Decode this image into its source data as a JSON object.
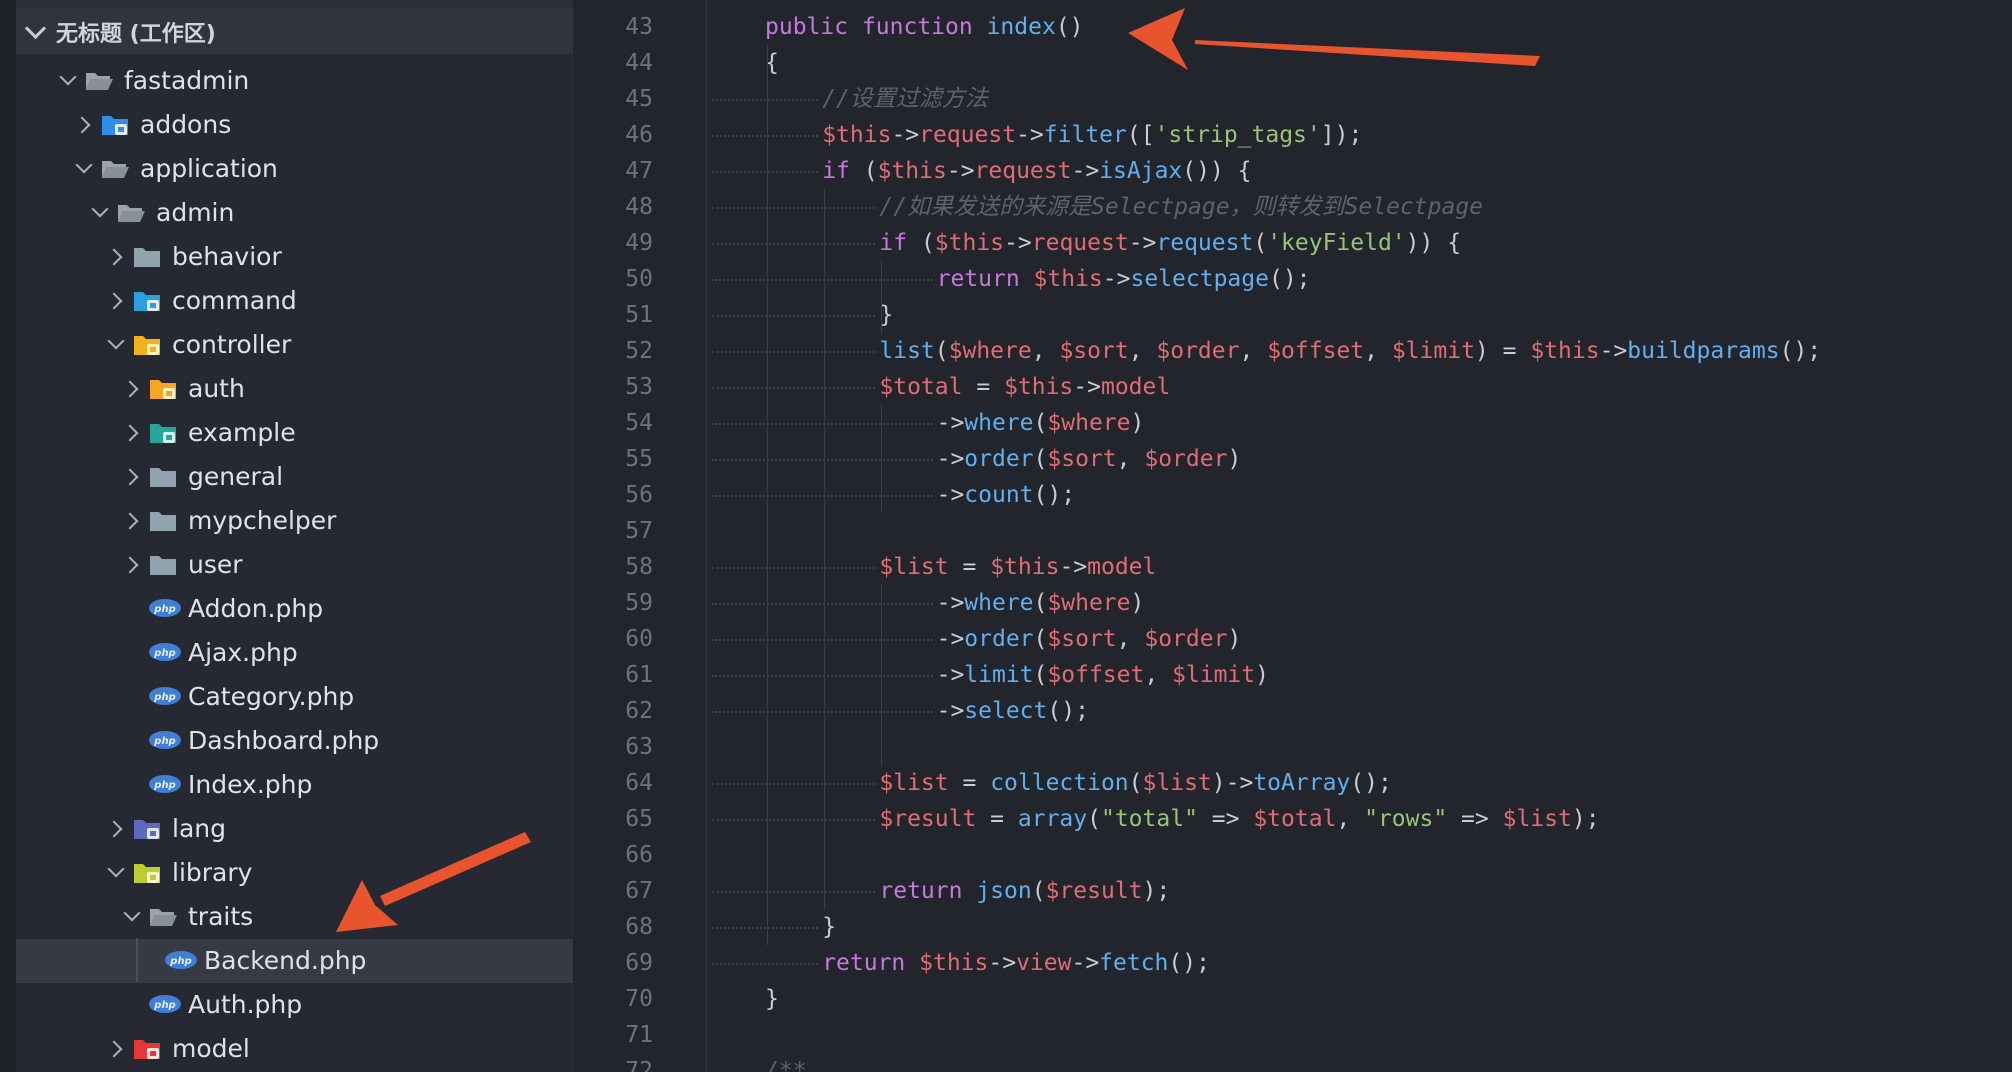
{
  "colors": {
    "accent_arrow": "#e8542e",
    "keyword": "#c678dd",
    "function": "#61afef",
    "variable": "#e06c75",
    "string": "#98c379",
    "comment": "#5c6370"
  },
  "sidebar": {
    "workspace_title": "无标题 (工作区)",
    "items": [
      {
        "label": "fastadmin",
        "icon": "folder-open-icon"
      },
      {
        "label": "addons",
        "icon": "puzzle-folder-icon"
      },
      {
        "label": "application",
        "icon": "folder-open-icon"
      },
      {
        "label": "admin",
        "icon": "folder-open-icon"
      },
      {
        "label": "behavior",
        "icon": "folder-icon"
      },
      {
        "label": "command",
        "icon": "command-folder-icon"
      },
      {
        "label": "controller",
        "icon": "gear-folder-icon"
      },
      {
        "label": "auth",
        "icon": "lock-folder-icon"
      },
      {
        "label": "example",
        "icon": "image-folder-icon"
      },
      {
        "label": "general",
        "icon": "folder-icon"
      },
      {
        "label": "mypchelper",
        "icon": "folder-icon"
      },
      {
        "label": "user",
        "icon": "folder-icon"
      },
      {
        "label": "Addon.php",
        "icon": "php-file-icon"
      },
      {
        "label": "Ajax.php",
        "icon": "php-file-icon"
      },
      {
        "label": "Category.php",
        "icon": "php-file-icon"
      },
      {
        "label": "Dashboard.php",
        "icon": "php-file-icon"
      },
      {
        "label": "Index.php",
        "icon": "php-file-icon"
      },
      {
        "label": "lang",
        "icon": "translate-folder-icon"
      },
      {
        "label": "library",
        "icon": "library-folder-icon"
      },
      {
        "label": "traits",
        "icon": "folder-open-icon"
      },
      {
        "label": "Backend.php",
        "icon": "php-file-icon"
      },
      {
        "label": "Auth.php",
        "icon": "php-file-icon"
      },
      {
        "label": "model",
        "icon": "model-folder-icon"
      }
    ]
  },
  "editor": {
    "line_numbers": [
      "43",
      "44",
      "45",
      "46",
      "47",
      "48",
      "49",
      "50",
      "51",
      "52",
      "53",
      "54",
      "55",
      "56",
      "57",
      "58",
      "59",
      "60",
      "61",
      "62",
      "63",
      "64",
      "65",
      "66",
      "67",
      "68",
      "69",
      "70",
      "71",
      "72"
    ],
    "lines": [
      [
        {
          "t": "public ",
          "c": "k"
        },
        {
          "t": "function ",
          "c": "k"
        },
        {
          "t": "index",
          "c": "f"
        },
        {
          "t": "()",
          "c": "p"
        }
      ],
      [
        {
          "t": "{",
          "c": "p"
        }
      ],
      [
        {
          "t": "//设置过滤方法",
          "c": "c"
        }
      ],
      [
        {
          "t": "$this",
          "c": "v"
        },
        {
          "t": "->",
          "c": "p"
        },
        {
          "t": "request",
          "c": "v"
        },
        {
          "t": "->",
          "c": "p"
        },
        {
          "t": "filter",
          "c": "f"
        },
        {
          "t": "([",
          "c": "p"
        },
        {
          "t": "'strip_tags'",
          "c": "s"
        },
        {
          "t": "]);",
          "c": "p"
        }
      ],
      [
        {
          "t": "if ",
          "c": "k"
        },
        {
          "t": "(",
          "c": "p"
        },
        {
          "t": "$this",
          "c": "v"
        },
        {
          "t": "->",
          "c": "p"
        },
        {
          "t": "request",
          "c": "v"
        },
        {
          "t": "->",
          "c": "p"
        },
        {
          "t": "isAjax",
          "c": "f"
        },
        {
          "t": "()) {",
          "c": "p"
        }
      ],
      [
        {
          "t": "//如果发送的来源是Selectpage，则转发到Selectpage",
          "c": "c"
        }
      ],
      [
        {
          "t": "if ",
          "c": "k"
        },
        {
          "t": "(",
          "c": "p"
        },
        {
          "t": "$this",
          "c": "v"
        },
        {
          "t": "->",
          "c": "p"
        },
        {
          "t": "request",
          "c": "v"
        },
        {
          "t": "->",
          "c": "p"
        },
        {
          "t": "request",
          "c": "f"
        },
        {
          "t": "(",
          "c": "p"
        },
        {
          "t": "'keyField'",
          "c": "s"
        },
        {
          "t": ")) {",
          "c": "p"
        }
      ],
      [
        {
          "t": "return ",
          "c": "k"
        },
        {
          "t": "$this",
          "c": "v"
        },
        {
          "t": "->",
          "c": "p"
        },
        {
          "t": "selectpage",
          "c": "f"
        },
        {
          "t": "();",
          "c": "p"
        }
      ],
      [
        {
          "t": "}",
          "c": "p"
        }
      ],
      [
        {
          "t": "list",
          "c": "f"
        },
        {
          "t": "(",
          "c": "p"
        },
        {
          "t": "$where",
          "c": "v"
        },
        {
          "t": ", ",
          "c": "p"
        },
        {
          "t": "$sort",
          "c": "v"
        },
        {
          "t": ", ",
          "c": "p"
        },
        {
          "t": "$order",
          "c": "v"
        },
        {
          "t": ", ",
          "c": "p"
        },
        {
          "t": "$offset",
          "c": "v"
        },
        {
          "t": ", ",
          "c": "p"
        },
        {
          "t": "$limit",
          "c": "v"
        },
        {
          "t": ") = ",
          "c": "p"
        },
        {
          "t": "$this",
          "c": "v"
        },
        {
          "t": "->",
          "c": "p"
        },
        {
          "t": "buildparams",
          "c": "f"
        },
        {
          "t": "();",
          "c": "p"
        }
      ],
      [
        {
          "t": "$total",
          "c": "v"
        },
        {
          "t": " = ",
          "c": "p"
        },
        {
          "t": "$this",
          "c": "v"
        },
        {
          "t": "->",
          "c": "p"
        },
        {
          "t": "model",
          "c": "v"
        }
      ],
      [
        {
          "t": "->",
          "c": "p"
        },
        {
          "t": "where",
          "c": "f"
        },
        {
          "t": "(",
          "c": "p"
        },
        {
          "t": "$where",
          "c": "v"
        },
        {
          "t": ")",
          "c": "p"
        }
      ],
      [
        {
          "t": "->",
          "c": "p"
        },
        {
          "t": "order",
          "c": "f"
        },
        {
          "t": "(",
          "c": "p"
        },
        {
          "t": "$sort",
          "c": "v"
        },
        {
          "t": ", ",
          "c": "p"
        },
        {
          "t": "$order",
          "c": "v"
        },
        {
          "t": ")",
          "c": "p"
        }
      ],
      [
        {
          "t": "->",
          "c": "p"
        },
        {
          "t": "count",
          "c": "f"
        },
        {
          "t": "();",
          "c": "p"
        }
      ],
      [],
      [
        {
          "t": "$list",
          "c": "v"
        },
        {
          "t": " = ",
          "c": "p"
        },
        {
          "t": "$this",
          "c": "v"
        },
        {
          "t": "->",
          "c": "p"
        },
        {
          "t": "model",
          "c": "v"
        }
      ],
      [
        {
          "t": "->",
          "c": "p"
        },
        {
          "t": "where",
          "c": "f"
        },
        {
          "t": "(",
          "c": "p"
        },
        {
          "t": "$where",
          "c": "v"
        },
        {
          "t": ")",
          "c": "p"
        }
      ],
      [
        {
          "t": "->",
          "c": "p"
        },
        {
          "t": "order",
          "c": "f"
        },
        {
          "t": "(",
          "c": "p"
        },
        {
          "t": "$sort",
          "c": "v"
        },
        {
          "t": ", ",
          "c": "p"
        },
        {
          "t": "$order",
          "c": "v"
        },
        {
          "t": ")",
          "c": "p"
        }
      ],
      [
        {
          "t": "->",
          "c": "p"
        },
        {
          "t": "limit",
          "c": "f"
        },
        {
          "t": "(",
          "c": "p"
        },
        {
          "t": "$offset",
          "c": "v"
        },
        {
          "t": ", ",
          "c": "p"
        },
        {
          "t": "$limit",
          "c": "v"
        },
        {
          "t": ")",
          "c": "p"
        }
      ],
      [
        {
          "t": "->",
          "c": "p"
        },
        {
          "t": "select",
          "c": "f"
        },
        {
          "t": "();",
          "c": "p"
        }
      ],
      [],
      [
        {
          "t": "$list",
          "c": "v"
        },
        {
          "t": " = ",
          "c": "p"
        },
        {
          "t": "collection",
          "c": "f"
        },
        {
          "t": "(",
          "c": "p"
        },
        {
          "t": "$list",
          "c": "v"
        },
        {
          "t": ")->",
          "c": "p"
        },
        {
          "t": "toArray",
          "c": "f"
        },
        {
          "t": "();",
          "c": "p"
        }
      ],
      [
        {
          "t": "$result",
          "c": "v"
        },
        {
          "t": " = ",
          "c": "p"
        },
        {
          "t": "array",
          "c": "f"
        },
        {
          "t": "(",
          "c": "p"
        },
        {
          "t": "\"total\"",
          "c": "s"
        },
        {
          "t": " => ",
          "c": "p"
        },
        {
          "t": "$total",
          "c": "v"
        },
        {
          "t": ", ",
          "c": "p"
        },
        {
          "t": "\"rows\"",
          "c": "s"
        },
        {
          "t": " => ",
          "c": "p"
        },
        {
          "t": "$list",
          "c": "v"
        },
        {
          "t": ");",
          "c": "p"
        }
      ],
      [],
      [
        {
          "t": "return ",
          "c": "k"
        },
        {
          "t": "json",
          "c": "f"
        },
        {
          "t": "(",
          "c": "p"
        },
        {
          "t": "$result",
          "c": "v"
        },
        {
          "t": ");",
          "c": "p"
        }
      ],
      [
        {
          "t": "}",
          "c": "p"
        }
      ],
      [
        {
          "t": "return ",
          "c": "k"
        },
        {
          "t": "$this",
          "c": "v"
        },
        {
          "t": "->",
          "c": "p"
        },
        {
          "t": "view",
          "c": "v"
        },
        {
          "t": "->",
          "c": "p"
        },
        {
          "t": "fetch",
          "c": "f"
        },
        {
          "t": "();",
          "c": "p"
        }
      ],
      [
        {
          "t": "}",
          "c": "p"
        }
      ],
      [],
      [
        {
          "t": "/**",
          "c": "c"
        }
      ]
    ]
  }
}
